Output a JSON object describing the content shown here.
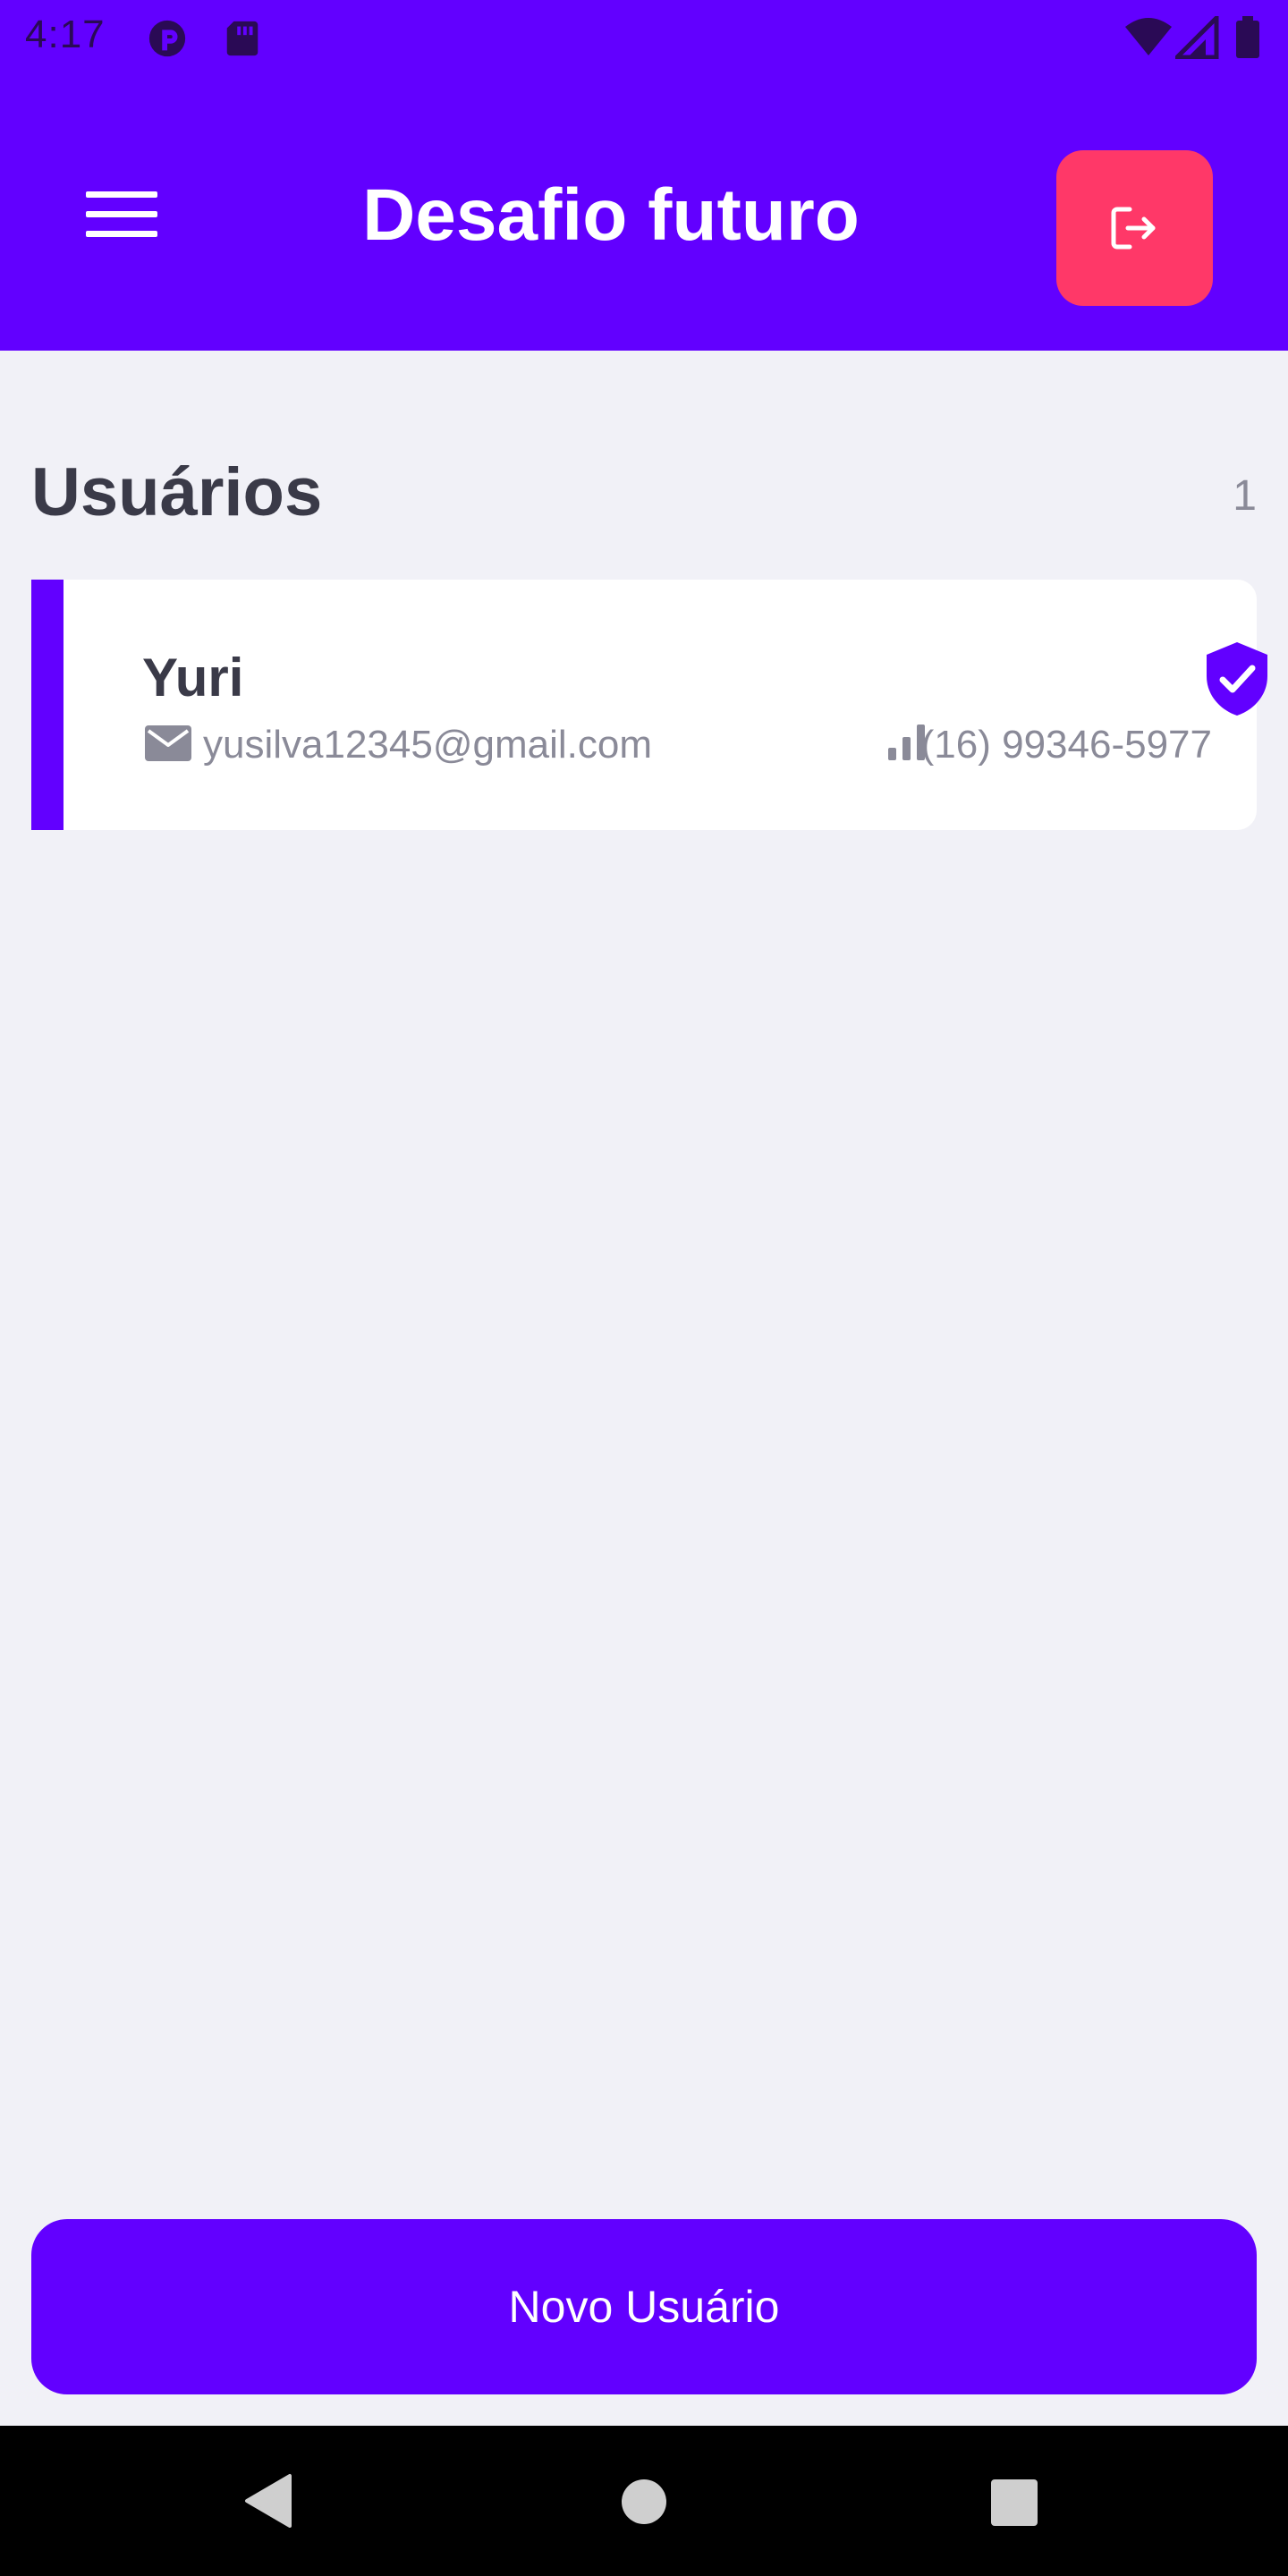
{
  "status_bar": {
    "time": "4:17",
    "left_icons": [
      "data-saver-icon",
      "sd-card-icon"
    ],
    "right_icons": [
      "wifi-icon",
      "cell-signal-icon",
      "battery-icon"
    ]
  },
  "header": {
    "title": "Desafio futuro",
    "menu_icon": "hamburger-menu-icon",
    "logout_icon": "logout-icon"
  },
  "section": {
    "title": "Usuários",
    "count": "1"
  },
  "users": [
    {
      "name": "Yuri",
      "email": "yusilva12345@gmail.com",
      "phone": "(16) 99346-5977",
      "verified": true,
      "email_icon": "mail-icon",
      "phone_icon": "signal-bars-icon",
      "status_icon": "verified-shield-icon"
    }
  ],
  "actions": {
    "new_user": "Novo Usuário"
  },
  "navigation": {
    "icons": [
      "back-icon",
      "home-icon",
      "recents-icon"
    ]
  },
  "colors": {
    "primary": "#6200FF",
    "danger": "#FF3868",
    "background": "#F1F1F7",
    "card": "#FFFFFF",
    "text_dark": "#3A3A48",
    "text_muted": "#8A8A98"
  }
}
